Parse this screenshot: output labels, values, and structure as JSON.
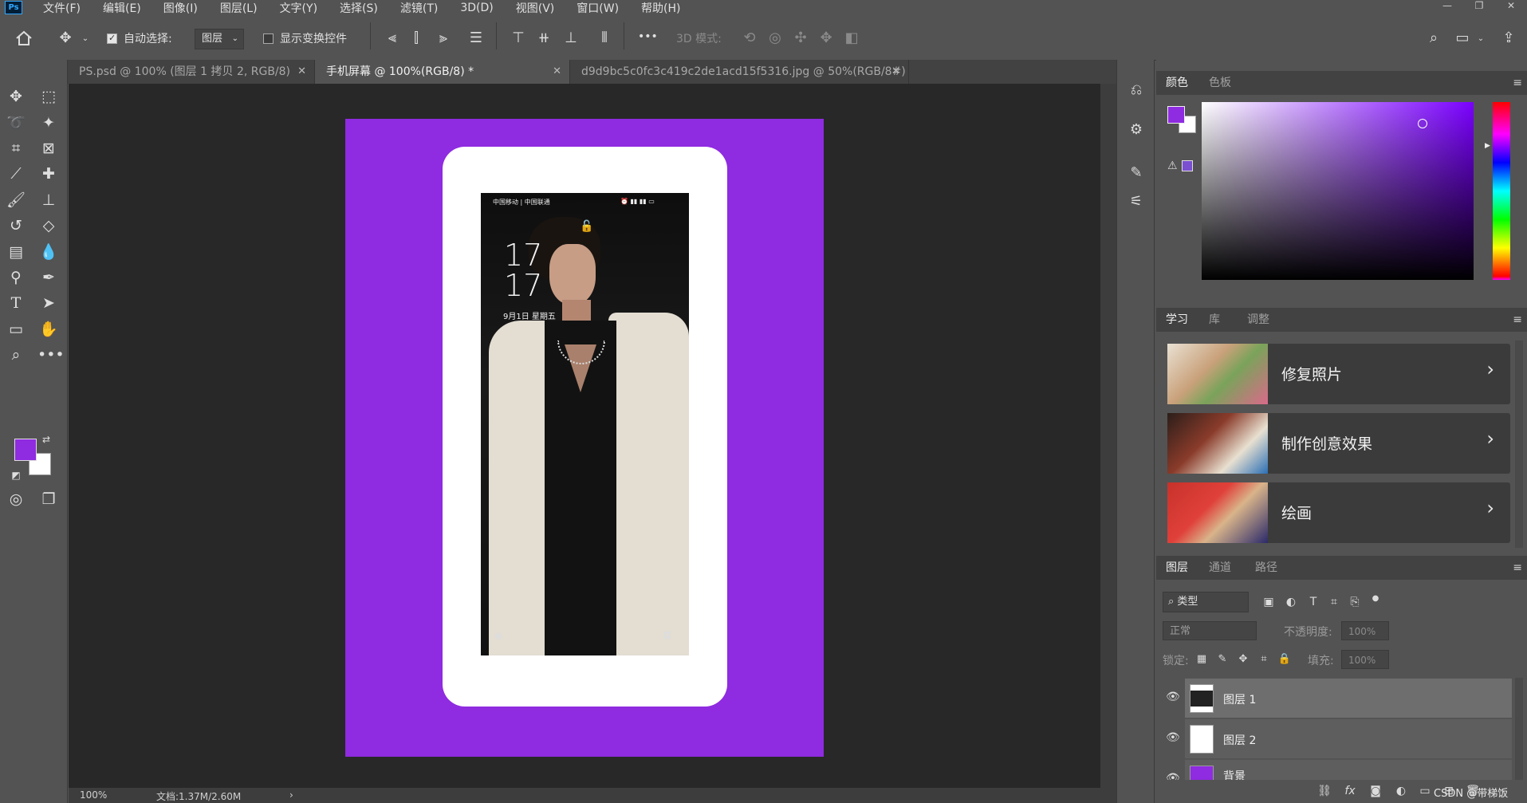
{
  "app": {
    "logo": "Ps"
  },
  "menu": [
    "文件(F)",
    "编辑(E)",
    "图像(I)",
    "图层(L)",
    "文字(Y)",
    "选择(S)",
    "滤镜(T)",
    "3D(D)",
    "视图(V)",
    "窗口(W)",
    "帮助(H)"
  ],
  "window_controls": [
    "—",
    "❐",
    "✕"
  ],
  "options": {
    "auto_select_label": "自动选择:",
    "auto_select_value": "图层",
    "show_transform_label": "显示变换控件",
    "mode3d_label": "3D 模式:",
    "more": "•••"
  },
  "tabs": [
    {
      "label": "PS.psd @ 100% (图层 1 拷贝 2, RGB/8)",
      "active": false
    },
    {
      "label": "手机屏幕 @ 100%(RGB/8) *",
      "active": true
    },
    {
      "label": "d9d9bc5c0fc3c419c2de1acd15f5316.jpg @ 50%(RGB/8#)",
      "active": false
    }
  ],
  "colors": {
    "foreground": "#8f2be0",
    "background": "#ffffff",
    "accent": "#31a8ff"
  },
  "phone": {
    "carrier": "中国移动 | 中国联通",
    "time_hour": "17",
    "time_min": "17",
    "date": "9月1日  星期五"
  },
  "status": {
    "zoom": "100%",
    "doc": "文档:1.37M/2.60M",
    "arrow": "›"
  },
  "panels": {
    "color": {
      "tabs": [
        "颜色",
        "色板"
      ]
    },
    "learn": {
      "tabs": [
        "学习",
        "库",
        "调整"
      ],
      "cards": [
        {
          "label": "修复照片"
        },
        {
          "label": "制作创意效果"
        },
        {
          "label": "绘画"
        }
      ]
    },
    "layers": {
      "tabs": [
        "图层",
        "通道",
        "路径"
      ],
      "filter_kind": "类型",
      "blend_mode": "正常",
      "opacity_label": "不透明度:",
      "opacity_value": "100%",
      "lock_label": "锁定:",
      "fill_label": "填充:",
      "fill_value": "100%",
      "items": [
        {
          "name": "图层 1"
        },
        {
          "name": "图层 2"
        },
        {
          "name": "背景"
        }
      ]
    }
  },
  "watermark": "CSDN @带梯饭"
}
